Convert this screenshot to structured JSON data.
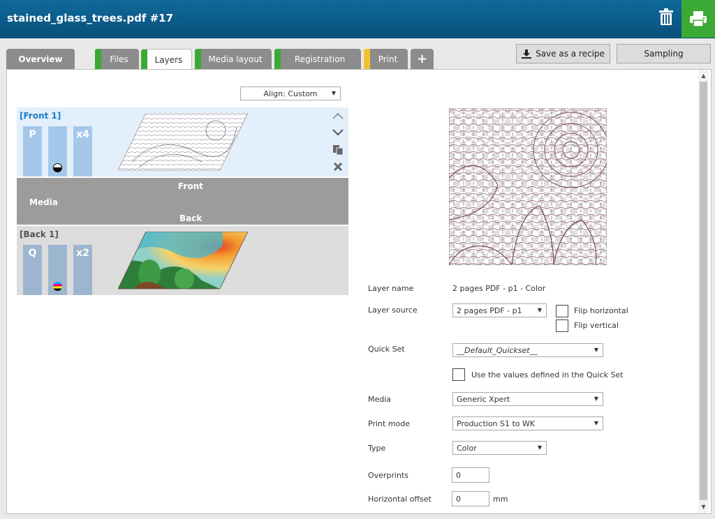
{
  "header": {
    "title": "stained_glass_trees.pdf #17",
    "delete_icon": "trash-icon",
    "print_icon": "printer-icon",
    "accent_color": "#3aaa35"
  },
  "tabs": [
    {
      "label": "Overview",
      "stripe": ""
    },
    {
      "label": "Files",
      "stripe": "#3aaa35"
    },
    {
      "label": "Layers",
      "stripe": "#3aaa35"
    },
    {
      "label": "Media layout",
      "stripe": "#3aaa35"
    },
    {
      "label": "Registration",
      "stripe": "#3aaa35"
    },
    {
      "label": "Print",
      "stripe": "#f2c230"
    },
    {
      "label": "+",
      "stripe": ""
    }
  ],
  "actions": {
    "save_recipe": "Save as a recipe",
    "sampling": "Sampling"
  },
  "align": {
    "value": "Align: Custom"
  },
  "layers": {
    "front": {
      "title": "[Front 1]",
      "chip_mode": "P",
      "chip_count": "x4",
      "ink": "black"
    },
    "media": {
      "front": "Front",
      "media": "Media",
      "back": "Back"
    },
    "back": {
      "title": "[Back 1]",
      "chip_mode": "Q",
      "chip_count": "x2",
      "ink": "cmyk"
    }
  },
  "form": {
    "layer_name_label": "Layer name",
    "layer_name_value": "2 pages PDF - p1 - Color",
    "layer_source_label": "Layer source",
    "layer_source_value": "2 pages PDF - p1",
    "flip_horizontal": "Flip horizontal",
    "flip_vertical": "Flip vertical",
    "quick_set_label": "Quick Set",
    "quick_set_value": "__Default_Quickset__",
    "use_values": "Use the values defined in the Quick Set",
    "media_label": "Media",
    "media_value": "Generic Xpert",
    "print_mode_label": "Print mode",
    "print_mode_value": "Production S1 to WK",
    "type_label": "Type",
    "type_value": "Color",
    "overprints_label": "Overprints",
    "overprints_value": "0",
    "h_offset_label": "Horizontal offset",
    "h_offset_value": "0",
    "h_offset_unit": "mm"
  }
}
